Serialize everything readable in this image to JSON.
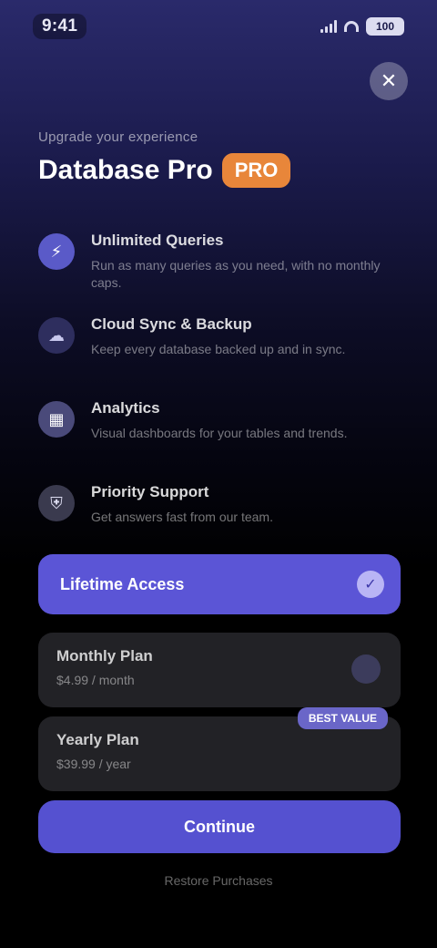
{
  "status_bar": {
    "time": "9:41",
    "battery": "100"
  },
  "header": {
    "close_icon": "close-icon",
    "eyebrow": "Upgrade your experience",
    "title": "Database Pro",
    "badge": "PRO"
  },
  "features": [
    {
      "icon": "bolt-icon",
      "glyph": "⚡",
      "title": "Unlimited Queries",
      "desc": "Run as many queries as you need, with no monthly caps."
    },
    {
      "icon": "cloud-icon",
      "glyph": "☁",
      "title": "Cloud Sync & Backup",
      "desc": "Keep every database backed up and in sync."
    },
    {
      "icon": "chart-icon",
      "glyph": "▦",
      "title": "Analytics",
      "desc": "Visual dashboards for your tables and trends."
    },
    {
      "icon": "shield-icon",
      "glyph": "⛨",
      "title": "Priority Support",
      "desc": "Get answers fast from our team."
    }
  ],
  "selected_plan": {
    "label": "Lifetime Access",
    "check_icon": "check-icon"
  },
  "plans": [
    {
      "name": "Monthly Plan",
      "price": "$4.99 / month"
    },
    {
      "name": "Yearly Plan",
      "price": "$39.99 / year",
      "badge": "BEST VALUE"
    }
  ],
  "cta": {
    "label": "Continue"
  },
  "footer": {
    "restore": "Restore Purchases"
  },
  "colors": {
    "accent": "#5b55d6",
    "badge": "#e8863a",
    "card": "#222226"
  }
}
